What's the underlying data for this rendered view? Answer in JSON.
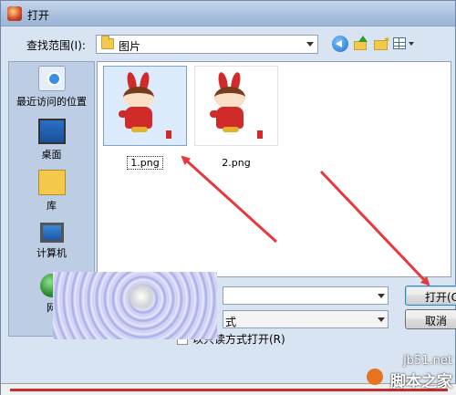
{
  "window": {
    "title": "打开"
  },
  "toolbar": {
    "look_in_label": "查找范围(I):",
    "look_in_value": "图片",
    "back_icon": "back-arrow-icon",
    "up_icon": "up-folder-icon",
    "new_folder_icon": "new-folder-icon",
    "views_icon": "views-menu-icon"
  },
  "places": [
    {
      "label": "最近访问的位置",
      "icon": "recent-places-icon"
    },
    {
      "label": "桌面",
      "icon": "desktop-icon"
    },
    {
      "label": "库",
      "icon": "library-icon"
    },
    {
      "label": "计算机",
      "icon": "computer-icon"
    },
    {
      "label": "网",
      "icon": "network-icon"
    }
  ],
  "files": [
    {
      "name": "1.png",
      "selected": true
    },
    {
      "name": "2.png",
      "selected": false
    }
  ],
  "footer": {
    "file_type_value": "式",
    "readonly_label": "以只读方式打开(R)",
    "open_button": "打开(O)",
    "cancel_button": "取消"
  },
  "watermark": {
    "url": "jb51.net",
    "site": "脚本之家"
  },
  "colors": {
    "arrow": "#e8383d",
    "selection": "#dcebfc",
    "titlebar": "#a9c0dd"
  }
}
